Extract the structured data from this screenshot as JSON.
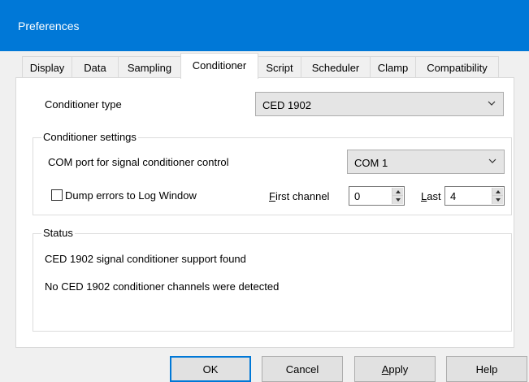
{
  "window": {
    "title": "Preferences"
  },
  "tabs": [
    {
      "label": "Display"
    },
    {
      "label": "Data"
    },
    {
      "label": "Sampling"
    },
    {
      "label": "Conditioner",
      "active": true
    },
    {
      "label": "Script"
    },
    {
      "label": "Scheduler"
    },
    {
      "label": "Clamp"
    },
    {
      "label": "Compatibility"
    }
  ],
  "conditioner": {
    "type_label": "Conditioner type",
    "type_value": "CED 1902"
  },
  "settings": {
    "group_label": "Conditioner settings",
    "com_label": "COM port for signal conditioner control",
    "com_value": "COM 1",
    "dump_label": "Dump errors to Log Window",
    "dump_checked": false,
    "first_label_pre": "",
    "first_label_u": "F",
    "first_label_post": "irst channel",
    "first_value": "0",
    "last_label_u": "L",
    "last_label_post": "ast",
    "last_value": "4"
  },
  "status": {
    "group_label": "Status",
    "line1": "CED 1902 signal conditioner support found",
    "line2": "No CED 1902 conditioner channels were detected"
  },
  "buttons": {
    "ok": "OK",
    "cancel": "Cancel",
    "apply_u": "A",
    "apply_rest": "pply",
    "help": "Help"
  }
}
